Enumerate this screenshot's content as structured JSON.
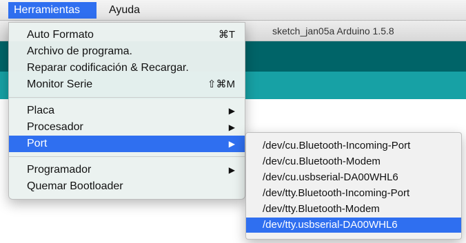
{
  "menubar": {
    "items": [
      {
        "label": "Herramientas",
        "active": true
      },
      {
        "label": "Ayuda",
        "active": false
      }
    ]
  },
  "window": {
    "title": "sketch_jan05a Arduino 1.5.8"
  },
  "colors": {
    "accent": "#2f6ff0",
    "toolbar": "#006468",
    "tabs": "#17a1a5"
  },
  "tools_menu": {
    "items": [
      {
        "label": "Auto Formato",
        "shortcut": "⌘T"
      },
      {
        "label": "Archivo de programa."
      },
      {
        "label": "Reparar codificación & Recargar."
      },
      {
        "label": "Monitor Serie",
        "shortcut": "⇧⌘M"
      },
      {
        "label": "Placa",
        "submenu": true,
        "arrow_icon": "triangle-right-icon"
      },
      {
        "label": "Procesador",
        "submenu": true,
        "arrow_icon": "triangle-right-icon"
      },
      {
        "label": "Port",
        "submenu": true,
        "highlighted": true,
        "arrow_icon": "triangle-right-icon"
      },
      {
        "label": "Programador",
        "submenu": true,
        "arrow_icon": "triangle-right-icon"
      },
      {
        "label": "Quemar Bootloader"
      }
    ]
  },
  "port_submenu": {
    "items": [
      {
        "label": "/dev/cu.Bluetooth-Incoming-Port"
      },
      {
        "label": "/dev/cu.Bluetooth-Modem"
      },
      {
        "label": "/dev/cu.usbserial-DA00WHL6"
      },
      {
        "label": "/dev/tty.Bluetooth-Incoming-Port"
      },
      {
        "label": "/dev/tty.Bluetooth-Modem"
      },
      {
        "label": "/dev/tty.usbserial-DA00WHL6",
        "highlighted": true
      }
    ]
  },
  "icons": {
    "submenu_arrow": "▶"
  }
}
